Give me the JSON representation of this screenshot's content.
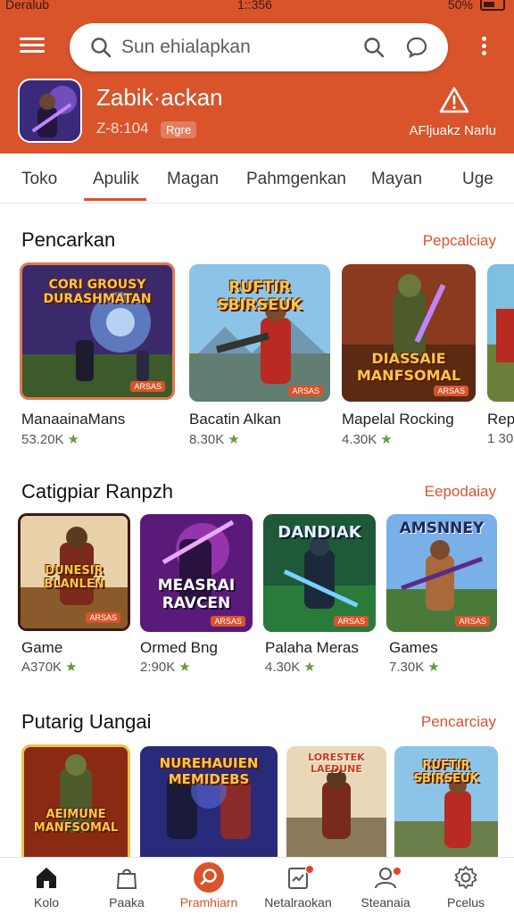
{
  "status_bar": {
    "carrier": "Deralub",
    "time": "1::356",
    "battery": "50%"
  },
  "header": {
    "search_placeholder": "Sun ehialapkan",
    "app_name": "Zabik·ackan",
    "app_meta": "Z-8:104",
    "app_badge": "Rgre",
    "alert_label": "AFljuakz Narlu"
  },
  "tabs": [
    {
      "label": "Toko"
    },
    {
      "label": "Apulik"
    },
    {
      "label": "Magan"
    },
    {
      "label": "Pahmgenkan"
    },
    {
      "label": "Mayan"
    },
    {
      "label": "Uge"
    }
  ],
  "sections": [
    {
      "title": "Pencarkan",
      "link": "Pepcalciay",
      "items": [
        {
          "art_title": "CORI GROUSY DURASHMATAN",
          "tag": "ARSAS",
          "name": "ManaainaMans",
          "rating": "53.20K"
        },
        {
          "art_title": "RUFTIR SBIRSEUK",
          "tag": "ARSAS",
          "name": "Bacatin Alkan",
          "rating": "8.30K"
        },
        {
          "art_title": "DIASSAIE MANFSOMAL",
          "tag": "ARSAS",
          "name": "Mapelal Rocking",
          "rating": "4.30K"
        },
        {
          "art_title": "",
          "tag": "",
          "name": "Rep",
          "rating": "1 30"
        }
      ]
    },
    {
      "title": "Catigpiar Ranpzh",
      "link": "Eepodaiay",
      "items": [
        {
          "art_title": "DUNESIR BLANLEN",
          "tag": "ARSAS",
          "name": "Game",
          "rating": "A370K"
        },
        {
          "art_title": "MEASRAI RAVCEN",
          "tag": "ARSAS",
          "name": "Ormed Bng",
          "rating": "2:90K"
        },
        {
          "art_title": "DANDIAK",
          "tag": "ARSAS",
          "name": "Palaha Meras",
          "rating": "4.30K"
        },
        {
          "art_title": "AMSNNEY",
          "tag": "ARSAS",
          "name": "Games",
          "rating": "7.30K"
        }
      ]
    },
    {
      "title": "Putarig Uangai",
      "link": "Pencarciay",
      "items": [
        {
          "art_title": "AEIMUNE MANFSOMAL",
          "tag": "",
          "name": "",
          "rating": ""
        },
        {
          "art_title": "NUREHAUIEN MEMIDEBS",
          "tag": "",
          "name": "",
          "rating": ""
        },
        {
          "art_title": "LORESTEK LAEDUNE",
          "tag": "",
          "name": "",
          "rating": ""
        },
        {
          "art_title": "RUFTIR SBIRSEUK",
          "tag": "",
          "name": "",
          "rating": ""
        }
      ]
    }
  ],
  "bottom_nav": [
    {
      "label": "Kolo",
      "icon": "home-icon"
    },
    {
      "label": "Paaka",
      "icon": "bag-icon"
    },
    {
      "label": "Pramhiarn",
      "icon": "search-circle-icon",
      "active": true
    },
    {
      "label": "Netalraokan",
      "icon": "doc-icon",
      "badge": true
    },
    {
      "label": "Steanaia",
      "icon": "user-icon",
      "badge": true
    },
    {
      "label": "Pcelus",
      "icon": "gear-icon"
    }
  ],
  "colors": {
    "accent": "#d9532b",
    "rating_star": "#6a9a3a"
  }
}
